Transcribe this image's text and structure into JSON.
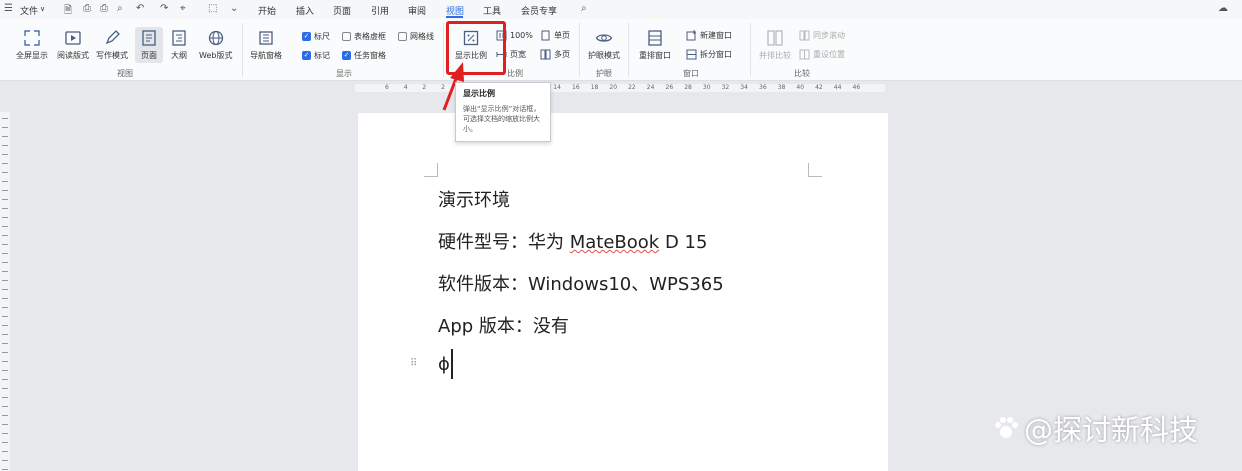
{
  "menubar": {
    "file": "文件",
    "file_caret": "∨",
    "tabs": [
      "开始",
      "插入",
      "页面",
      "引用",
      "审阅",
      "视图",
      "工具",
      "会员专享"
    ]
  },
  "ribbon": {
    "view_group": {
      "buttons": [
        "全屏显示",
        "阅读版式",
        "写作模式",
        "页面",
        "大纲",
        "Web版式"
      ],
      "label": "视图"
    },
    "show_group": {
      "nav_pane": "导航窗格",
      "ruler": "标尺",
      "marks": "标记",
      "table_gridlines": "表格虚框",
      "task_pane": "任务窗格",
      "gridlines": "网格线",
      "label": "显示"
    },
    "zoom_group": {
      "zoom": "显示比例",
      "percent": "100%",
      "page_width": "页宽",
      "single_page": "单页",
      "multi_page": "多页",
      "label": "比例"
    },
    "eye_group": {
      "eye_mode": "护眼模式",
      "label": "护眼"
    },
    "window_group": {
      "arrange": "重排窗口",
      "new_window": "新建窗口",
      "split": "拆分窗口",
      "label": "窗口"
    },
    "compare_group": {
      "side_by_side": "并排比较",
      "sync_scroll": "同步滚动",
      "reset_position": "重设位置",
      "label": "比较"
    }
  },
  "tooltip": {
    "title": "显示比例",
    "desc": "弹出“显示比例”对话框，可选择文档的缩放比例大小。"
  },
  "ruler": {
    "h_labels": [
      "6",
      "4",
      "2",
      "2",
      "4",
      "6",
      "8",
      "10",
      "12",
      "14",
      "16",
      "18",
      "20",
      "22",
      "24",
      "26",
      "28",
      "30",
      "32",
      "34",
      "36",
      "38",
      "40",
      "42",
      "44",
      "46"
    ]
  },
  "document": {
    "lines": [
      "演示环境",
      "硬件型号：华为 ",
      "MateBook",
      " D 15",
      "软件版本：Windows10、WPS365",
      "App 版本：没有",
      "ϕ"
    ]
  },
  "watermark": "@探讨新科技",
  "colors": {
    "accent": "#2b6de6",
    "highlight": "#e02020"
  }
}
